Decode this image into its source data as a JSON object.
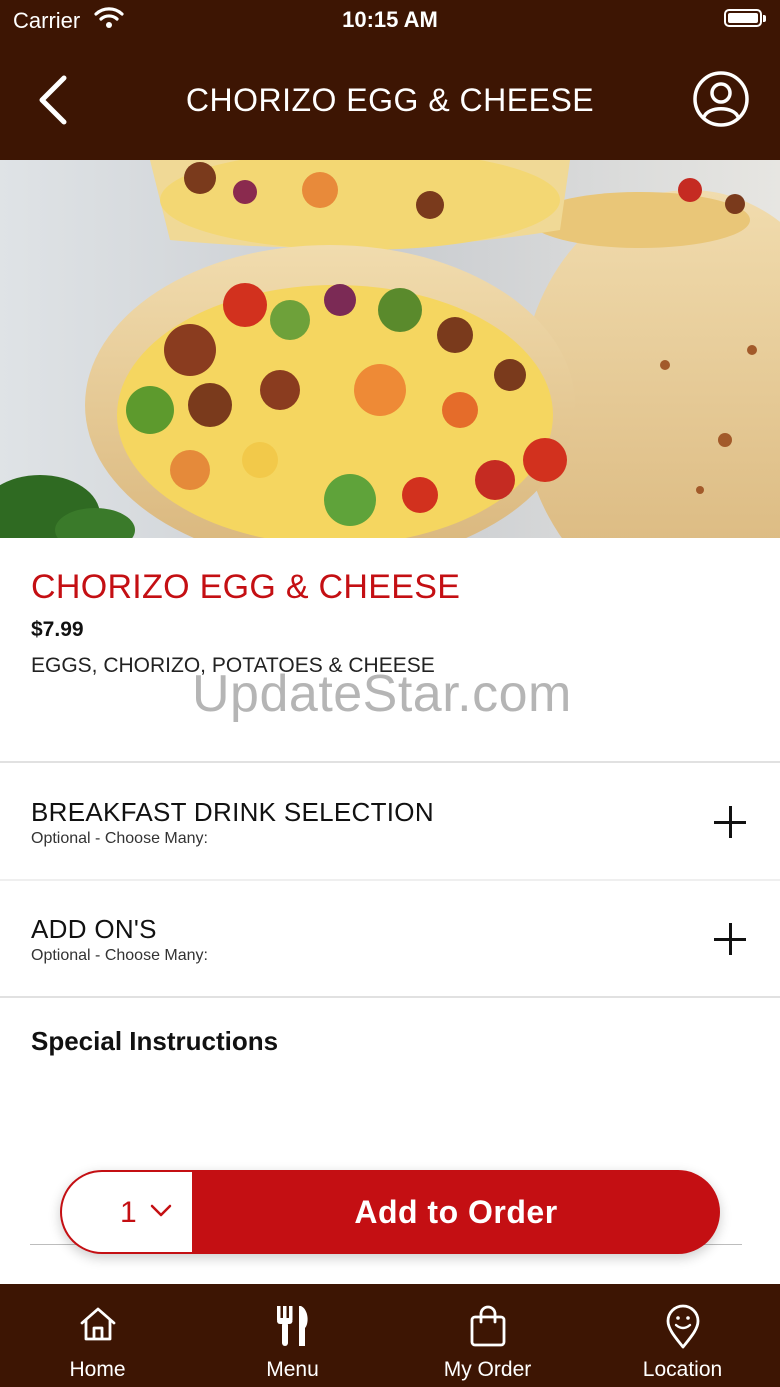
{
  "status_bar": {
    "carrier": "Carrier",
    "time": "10:15 AM"
  },
  "nav": {
    "title": "CHORIZO EGG & CHEESE",
    "back_icon": "chevron-left-icon",
    "profile_icon": "user-circle-icon"
  },
  "hero": {
    "image": "burrito-photo"
  },
  "item": {
    "name": "CHORIZO EGG & CHEESE",
    "price": "$7.99",
    "description": "EGGS, CHORIZO, POTATOES & CHEESE"
  },
  "watermark": "UpdateStar.com",
  "options": [
    {
      "title": "BREAKFAST DRINK SELECTION",
      "subtitle": "Optional - Choose Many:"
    },
    {
      "title": "ADD ON'S",
      "subtitle": "Optional - Choose Many:"
    }
  ],
  "special_instructions": {
    "label": "Special Instructions"
  },
  "order": {
    "quantity": "1",
    "add_label": "Add to Order"
  },
  "tabs": [
    {
      "label": "Home",
      "icon": "home-icon"
    },
    {
      "label": "Menu",
      "icon": "fork-knife-icon"
    },
    {
      "label": "My Order",
      "icon": "shopping-bag-icon"
    },
    {
      "label": "Location",
      "icon": "location-pin-icon"
    }
  ],
  "colors": {
    "brand_brown": "#3d1503",
    "accent_red": "#c40f13"
  }
}
